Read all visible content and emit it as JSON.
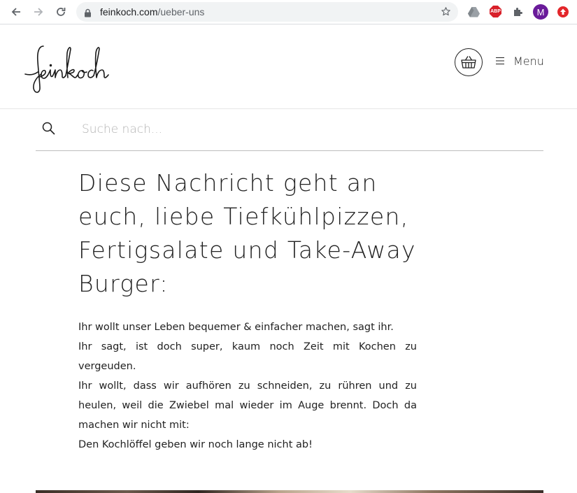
{
  "browser": {
    "url_host": "feinkoch.com",
    "url_path": "/ueber-uns",
    "avatar_letter": "M",
    "abp_label": "ABP",
    "icons": [
      "back-icon",
      "forward-icon",
      "reload-icon",
      "lock-icon",
      "star-icon",
      "google-drive-icon",
      "adblock-plus-icon",
      "extensions-puzzle-icon",
      "profile-avatar",
      "update-icon"
    ]
  },
  "header": {
    "logo_text": "feinkoch",
    "menu_label": "Menu",
    "icons": [
      "basket-icon",
      "hamburger-icon"
    ]
  },
  "search": {
    "placeholder": "Suche nach...",
    "value": ""
  },
  "article": {
    "headline": "Diese Nachricht geht an euch, liebe Tiefkühlpizzen, Fertigsalate und Take-Away Burger:",
    "paragraphs": [
      "Ihr wollt unser Leben bequemer & einfacher machen, sagt ihr.",
      "Ihr sagt, ist doch super, kaum noch Zeit mit Kochen zu vergeuden.",
      "Ihr wollt, dass wir aufhören zu schneiden, zu rühren und zu heulen, weil die Zwiebel mal wieder im Auge brennt. Doch da machen wir nicht mit:",
      "Den Kochlöffel geben wir noch lange nicht ab!"
    ]
  },
  "colors": {
    "text": "#222222",
    "placeholder": "#b3b3b3",
    "omnibox_bg": "#f1f3f4",
    "avatar": "#6a1b9a",
    "abp": "#d8202a"
  }
}
